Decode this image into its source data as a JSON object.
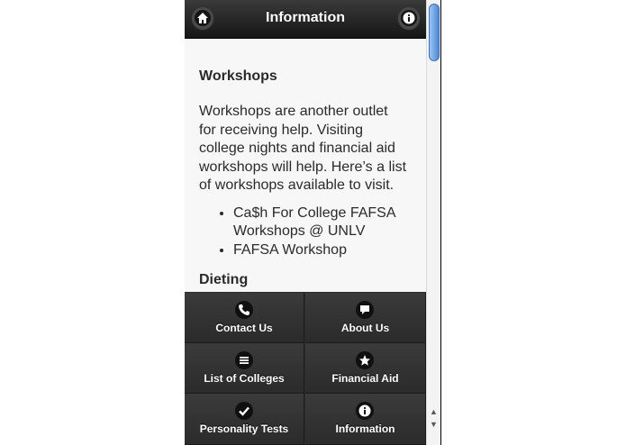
{
  "header": {
    "title": "Information"
  },
  "content": {
    "section_title": "Workshops",
    "paragraph": "Workshops are another outlet for receiving help. Visiting college nights and financial aid workshops will help. Here’s a list of workshops available to visit.",
    "list_items": [
      "Ca$h For College FAFSA Workshops @ UNLV",
      "FAFSA Workshop"
    ],
    "next_title": "Dieting"
  },
  "nav": [
    {
      "label": "Contact Us",
      "icon": "phone-icon"
    },
    {
      "label": "About Us",
      "icon": "chat-bubble-icon"
    },
    {
      "label": "List of Colleges",
      "icon": "list-icon"
    },
    {
      "label": "Financial Aid",
      "icon": "star-icon"
    },
    {
      "label": "Personality Tests",
      "icon": "checkmark-icon"
    },
    {
      "label": "Information",
      "icon": "info-icon"
    }
  ],
  "colors": {
    "header": "#1e1e1e",
    "nav": "#333333",
    "content_bg": "#f7f7f7",
    "scroll_thumb": "#4a89d8"
  }
}
